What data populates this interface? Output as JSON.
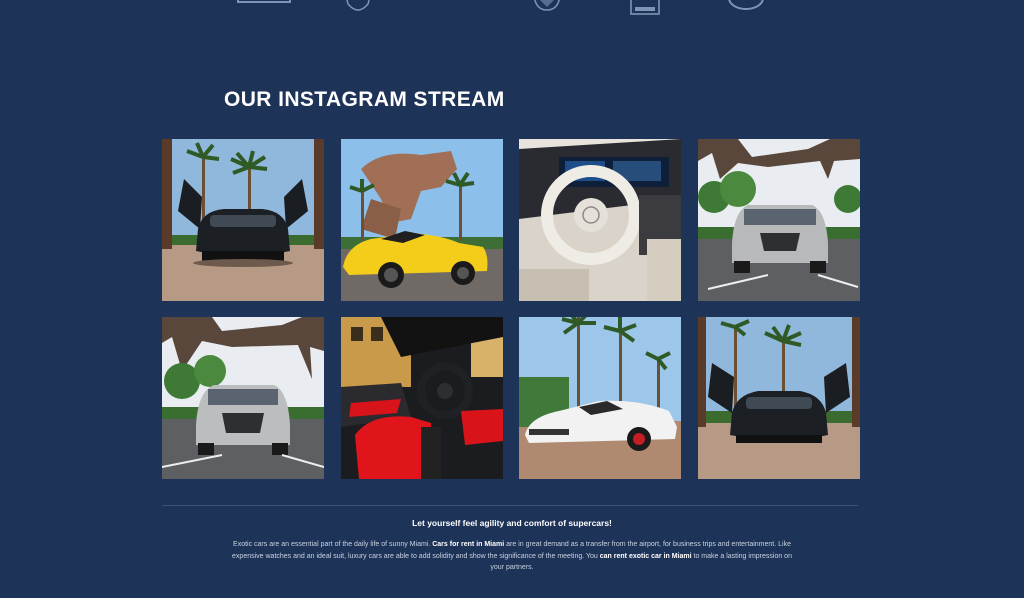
{
  "section": {
    "title": "OUR INSTAGRAM STREAM"
  },
  "brand_logos": [
    {
      "name": "brand-logo-1",
      "icon": "wordmark-icon"
    },
    {
      "name": "brand-logo-2",
      "icon": "crest-icon"
    },
    {
      "name": "brand-logo-3",
      "icon": "shield-icon"
    },
    {
      "name": "brand-logo-4",
      "icon": "badge-icon"
    },
    {
      "name": "brand-logo-5",
      "icon": "round-emblem-icon"
    }
  ],
  "gallery": [
    {
      "alt": "Black McLaren with butterfly doors open under palm trees"
    },
    {
      "alt": "Yellow Ferrari convertible in front of pegasus statue"
    },
    {
      "alt": "Mercedes-Maybach white leather steering wheel interior"
    },
    {
      "alt": "Silver Lexus SUV under horse statue"
    },
    {
      "alt": "Silver Lexus SUV front view under horse statue"
    },
    {
      "alt": "Ferrari convertible red leather interior"
    },
    {
      "alt": "White Lamborghini Huracan under palm trees"
    },
    {
      "alt": "Black McLaren with butterfly doors open front view"
    }
  ],
  "footer": {
    "tagline": "Let yourself feel agility and comfort of supercars!",
    "desc_1": "Exotic cars are an essential part of the daily life of sunny Miami. ",
    "desc_bold_1": "Cars for rent in Miami",
    "desc_2": " are in great demand as a transfer from the airport, for business trips and entertainment. Like expensive watches and an ideal suit, luxury cars are able to add solidity and show the significance of the meeting. You ",
    "desc_bold_2": "can rent exotic car in Miami",
    "desc_3": " to make a lasting impression on your partners."
  },
  "colors": {
    "background": "#1e3358",
    "title": "#ffffff",
    "body_text": "#c9d3e2"
  }
}
